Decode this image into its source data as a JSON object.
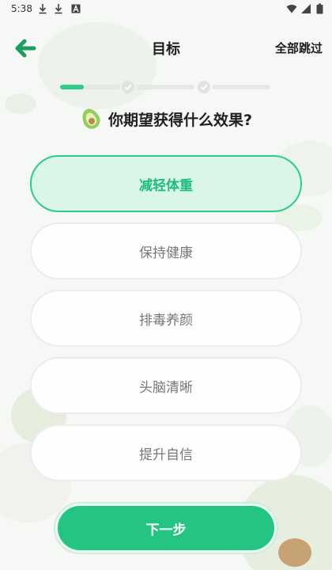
{
  "status_bar": {
    "time": "5:38",
    "icons": [
      "download-icon",
      "download-icon",
      "accessibility-a-icon",
      "wifi-icon",
      "cellular-signal-icon",
      "battery-icon"
    ]
  },
  "header": {
    "title": "目标",
    "skip_label": "全部跳过",
    "back_icon": "arrow-left-icon"
  },
  "progress": {
    "step_count": 3,
    "completed_dots": 2,
    "first_segment_fill": 0.4
  },
  "question": {
    "icon": "avocado-icon",
    "text": "你期望获得什么效果?"
  },
  "options": [
    {
      "label": "减轻体重",
      "selected": true
    },
    {
      "label": "保持健康",
      "selected": false
    },
    {
      "label": "排毒养颜",
      "selected": false
    },
    {
      "label": "头脑清晰",
      "selected": false
    },
    {
      "label": "提升自信",
      "selected": false
    }
  ],
  "next_button": {
    "label": "下一步"
  },
  "colors": {
    "accent": "#24c582",
    "accent_light": "#d9f6e8",
    "text_dark": "#1d1d1d",
    "text_muted": "#777777",
    "border": "#ececec"
  }
}
